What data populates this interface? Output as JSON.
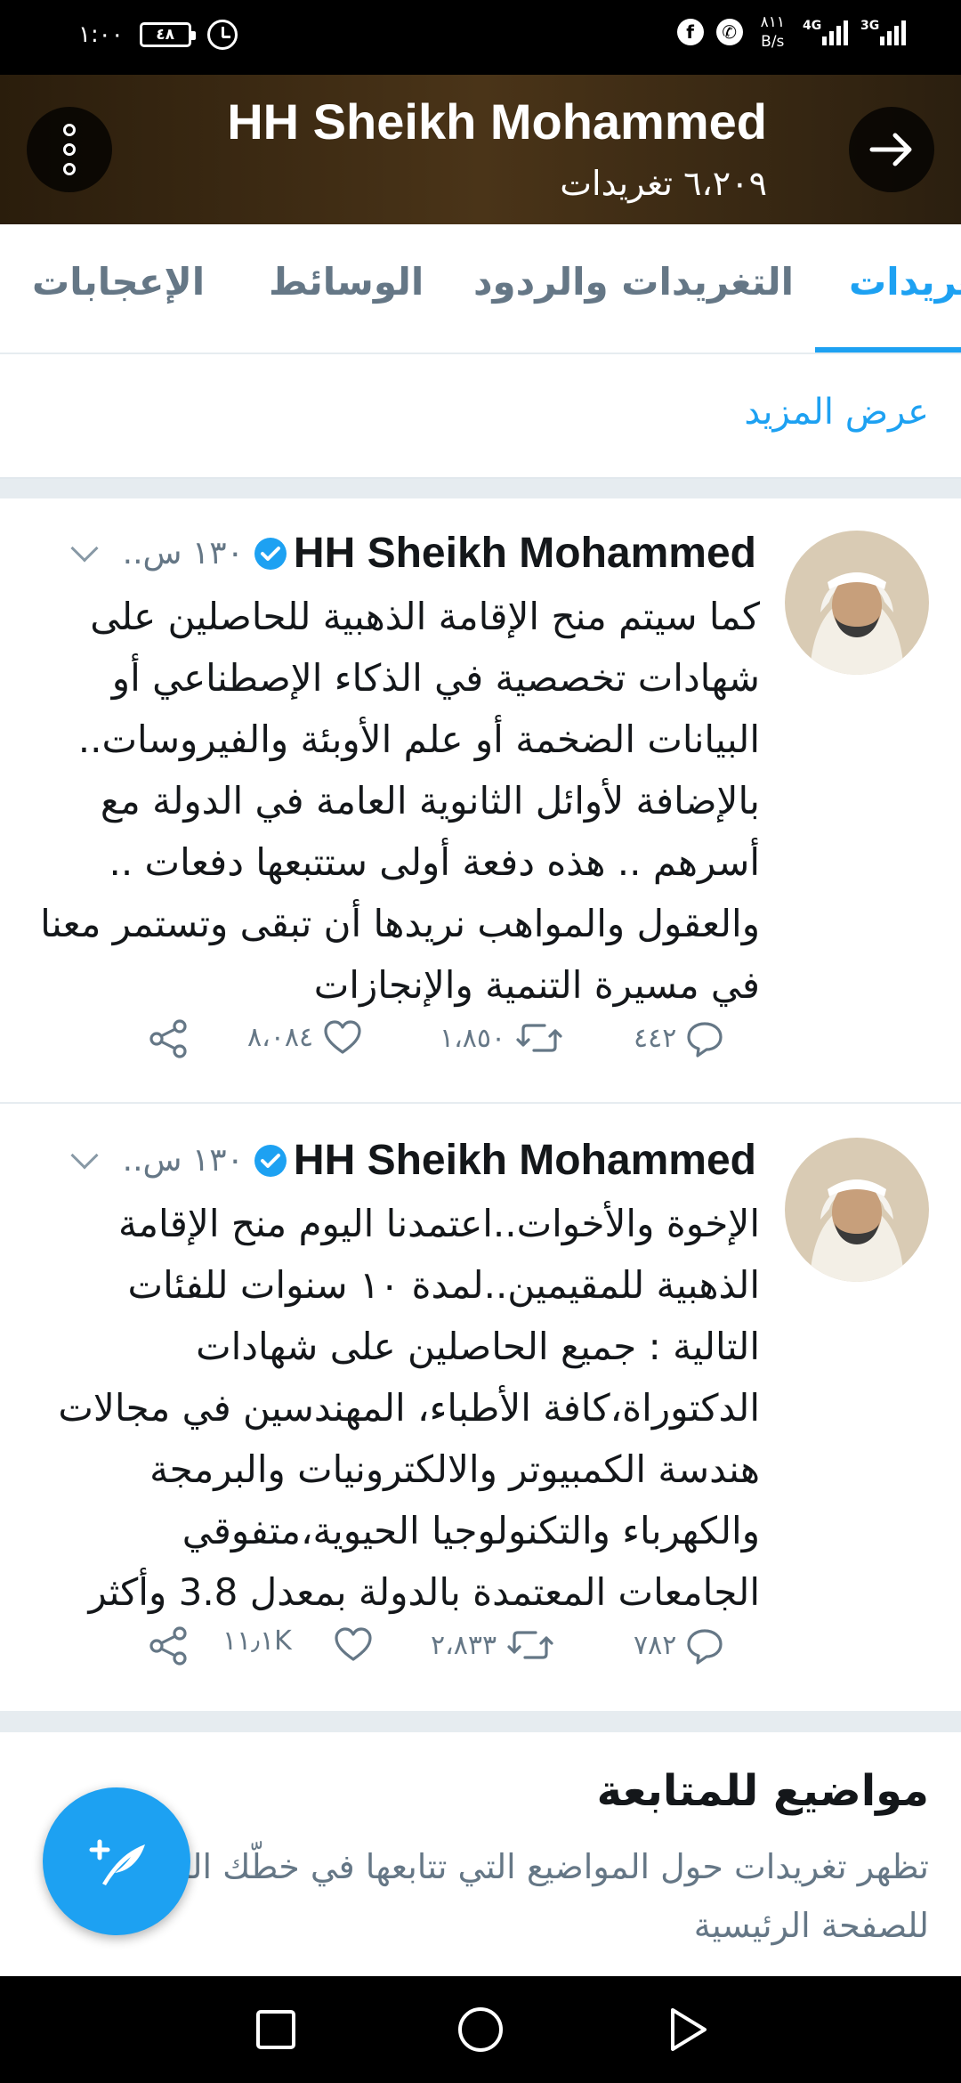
{
  "status_bar": {
    "time": "١:٠٠",
    "battery": "٤٨",
    "net_speed_value": "٨١١",
    "net_speed_unit": "B/s",
    "signal1_gen": "4G",
    "signal2_gen": "3G",
    "facebook_glyph": "f",
    "whatsapp_glyph": "✆"
  },
  "header": {
    "title": "HH Sheikh Mohammed",
    "tweet_count": "٦،٢٠٩ تغريدات",
    "back_icon": "arrow-right-icon",
    "more_icon": "more-vertical-icon"
  },
  "tabs": [
    {
      "label": "تغريدات",
      "active": true
    },
    {
      "label": "التغريدات والردود",
      "active": false
    },
    {
      "label": "الوسائط",
      "active": false
    },
    {
      "label": "الإعجابات",
      "active": false
    }
  ],
  "show_more": "عرض المزيد",
  "tweets": [
    {
      "name": "HH Sheikh Mohammed",
      "verified": true,
      "time": "..١٣٠ س",
      "text": "كما سيتم منح الإقامة الذهبية للحاصلين على شهادات تخصصية في الذكاء الإصطناعي أو البيانات الضخمة أو علم الأوبئة والفيروسات.. بالإضافة لأوائل الثانوية العامة في الدولة مع أسرهم .. هذه دفعة أولى ستتبعها دفعات .. والعقول والمواهب نريدها أن تبقى وتستمر معنا في مسيرة التنمية والإنجازات",
      "replies": "٤٤٢",
      "retweets": "١،٨٥٠",
      "likes": "٨،٠٨٤"
    },
    {
      "name": "HH Sheikh Mohammed",
      "verified": true,
      "time": "..١٣٠ س",
      "text": "الإخوة والأخوات..اعتمدنا اليوم منح الإقامة الذهبية للمقيمين..لمدة ١٠ سنوات للفئات التالية : جميع الحاصلين على شهادات الدكتوراة،كافة الأطباء، المهندسين في مجالات هندسة الكمبيوتر والالكترونيات والبرمجة والكهرباء والتكنولوجيا الحيوية،متفوقي الجامعات المعتمدة بالدولة بمعدل 3.8 وأكثر",
      "replies": "٧٨٢",
      "retweets": "٢،٨٣٣",
      "likes": "١١٫١K"
    }
  ],
  "topics": {
    "title": "مواضيع للمتابعة",
    "description": "تظهر تغريدات حول المواضيع التي تتابعها في خطّك الزمني للصفحة الرئيسية"
  },
  "colors": {
    "accent": "#1da1f2",
    "text": "#14171a",
    "muted": "#657786",
    "header_bg": "#3b2a12"
  }
}
